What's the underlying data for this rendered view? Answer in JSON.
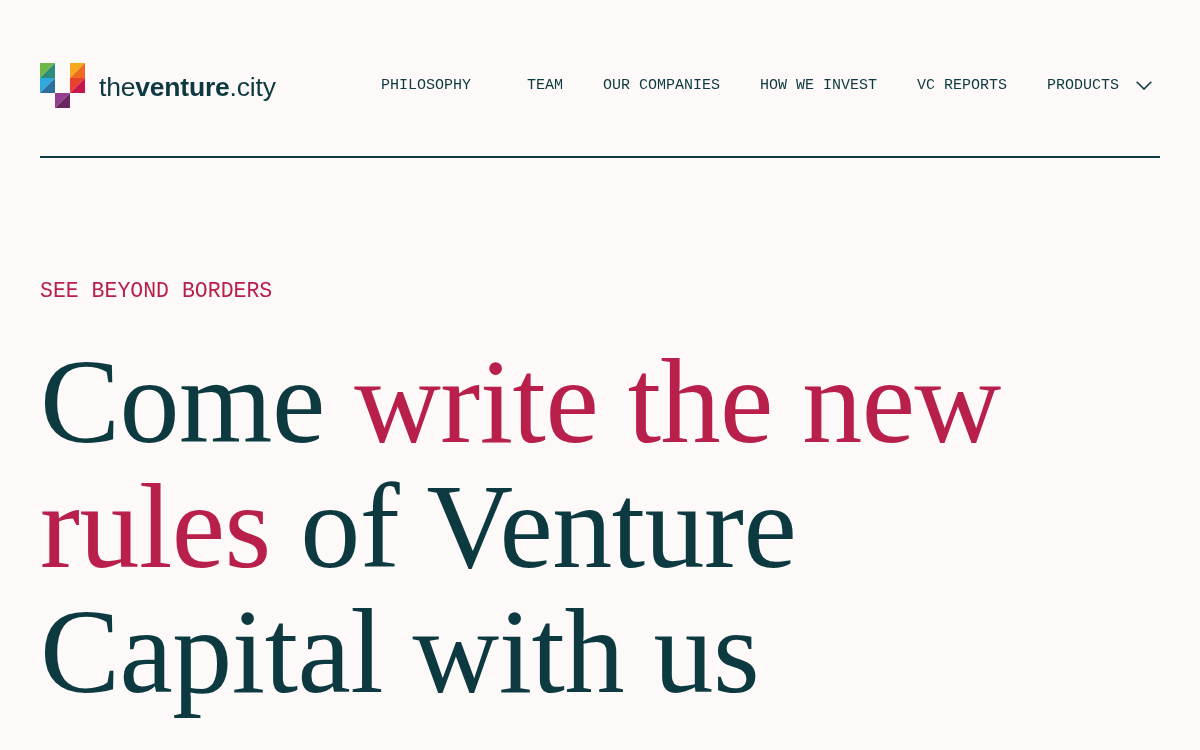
{
  "header": {
    "logo": {
      "wordmark": "the**venture**.city"
    },
    "nav": [
      {
        "label": "PHILOSOPHY",
        "kind": "link"
      },
      {
        "label": "TEAM",
        "kind": "link"
      },
      {
        "label": "OUR COMPANIES",
        "kind": "link"
      },
      {
        "label": "HOW WE INVEST",
        "kind": "link"
      },
      {
        "label": "VC REPORTS",
        "kind": "link"
      },
      {
        "label": "PRODUCTS",
        "kind": "dropdown"
      }
    ]
  },
  "hero": {
    "eyebrow": "SEE BEYOND BORDERS",
    "headline": [
      {
        "text": "Come",
        "highlighted": false
      },
      {
        "text": "write the new rules",
        "highlighted": true
      },
      {
        "text": "of Venture Capital with us",
        "highlighted": false
      }
    ]
  }
}
